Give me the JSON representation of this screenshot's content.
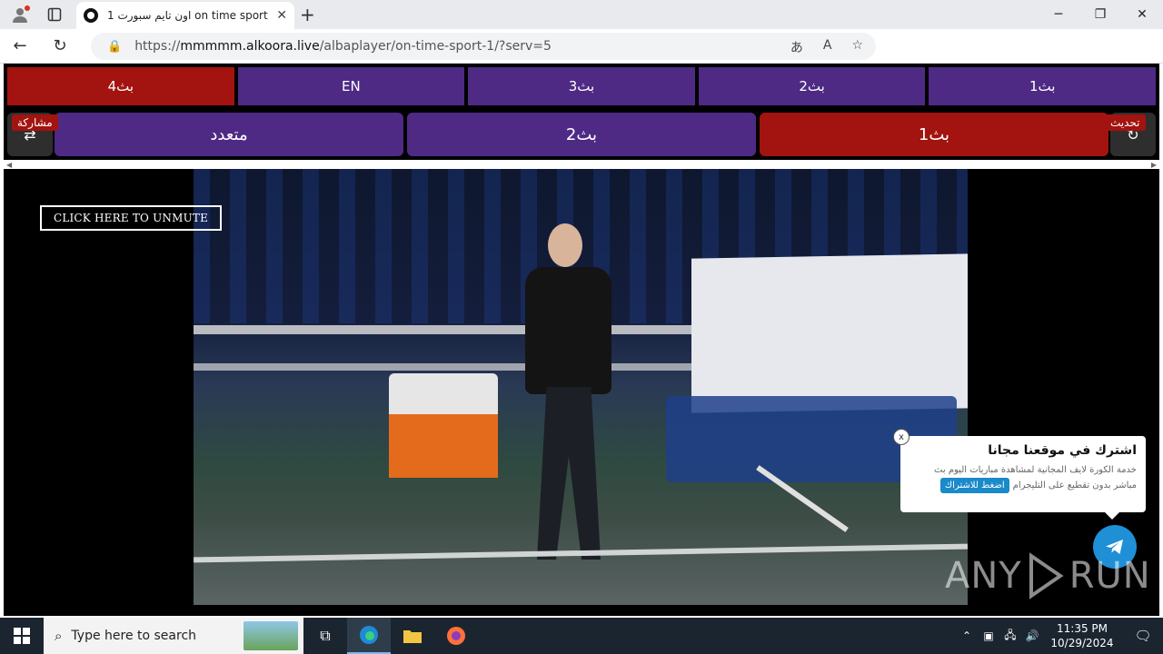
{
  "browser": {
    "tab_title": "اون تايم سبورت 1 on time sport",
    "url_prefix": "https://",
    "url_host": "mmmmm.alkoora.live",
    "url_path": "/albaplayer/on-time-sport-1/?serv=5"
  },
  "page": {
    "row1": [
      {
        "label": "بث4",
        "active": true
      },
      {
        "label": "EN",
        "active": false
      },
      {
        "label": "بث3",
        "active": false
      },
      {
        "label": "بث2",
        "active": false
      },
      {
        "label": "بث1",
        "active": false
      }
    ],
    "row2": {
      "share_label": "مشاركة",
      "refresh_label": "تحديث",
      "multi_label": "متعدد",
      "stream2_label": "بث2",
      "stream1_label": "بث1"
    },
    "unmute_label": "CLICK HERE TO UNMUTE",
    "popup": {
      "close": "x",
      "title": "اشترك في موقعنا مجانا",
      "text1": "خدمة الكورة لايف المجانية لمشاهدة مباريات اليوم بث",
      "text2": "مباشر بدون تقطيع على التليجرام",
      "button": "اضغط للاشتراك"
    },
    "watermark_left": "ANY",
    "watermark_right": "RUN",
    "colors": {
      "purple": "#4e2a85",
      "red": "#a3130f",
      "telegram": "#1f8fd6"
    }
  },
  "taskbar": {
    "search_placeholder": "Type here to search",
    "time": "11:35 PM",
    "date": "10/29/2024"
  }
}
